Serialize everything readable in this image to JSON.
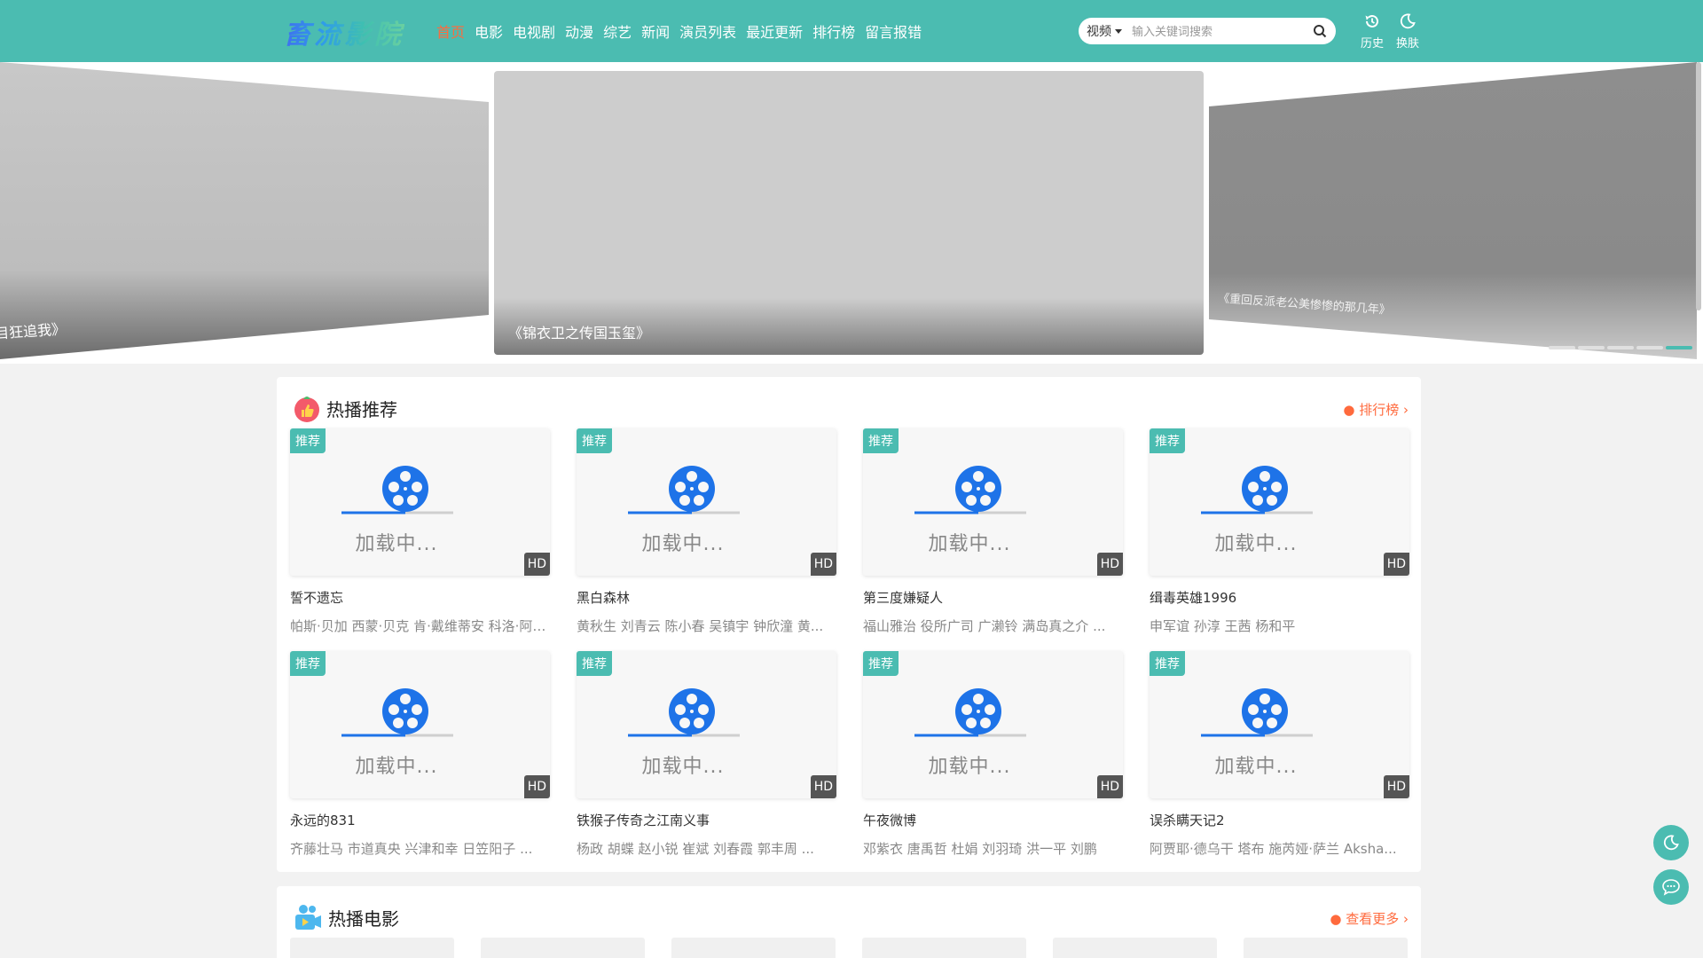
{
  "header": {
    "logo_text": "畜流影院",
    "nav": [
      "首页",
      "电影",
      "电视剧",
      "动漫",
      "综艺",
      "新闻",
      "演员列表",
      "最近更新",
      "排行榜",
      "留言报错"
    ],
    "search_type": "视频",
    "search_placeholder": "输入关键词搜索",
    "history_label": "历史",
    "theme_label": "换肤"
  },
  "carousel": {
    "left_caption": "目狂追我》",
    "center_caption": "《锦衣卫之传国玉玺》",
    "right_caption": "《重回反派老公美惨惨的那几年》",
    "active_dot": 4
  },
  "hot": {
    "title": "热播推荐",
    "more": "排行榜",
    "items": [
      {
        "badge": "推荐",
        "quality": "HD",
        "loading": "加载中...",
        "name": "誓不遗忘",
        "cast": "帕斯·贝加 西蒙·贝克 肯·戴维蒂安 科洛·阿林托 ..."
      },
      {
        "badge": "推荐",
        "quality": "HD",
        "loading": "加载中...",
        "name": "黑白森林",
        "cast": "黄秋生 刘青云 陈小春 吴镇宇 钟欣潼 黄..."
      },
      {
        "badge": "推荐",
        "quality": "HD",
        "loading": "加载中...",
        "name": "第三度嫌疑人",
        "cast": "福山雅治 役所广司 广濑铃 满岛真之介 ..."
      },
      {
        "badge": "推荐",
        "quality": "HD",
        "loading": "加载中...",
        "name": "缉毒英雄1996",
        "cast": "申军谊 孙淳 王茜 杨和平"
      },
      {
        "badge": "推荐",
        "quality": "HD",
        "loading": "加载中...",
        "name": "永远的831",
        "cast": "齐藤壮马 市道真央 兴津和幸 日笠阳子 ..."
      },
      {
        "badge": "推荐",
        "quality": "HD",
        "loading": "加载中...",
        "name": "铁猴子传奇之江南义事",
        "cast": "杨政 胡蝶 赵小锐 崔斌 刘春霞 郭丰周 ..."
      },
      {
        "badge": "推荐",
        "quality": "HD",
        "loading": "加载中...",
        "name": "午夜微博",
        "cast": "邓紫衣 唐禹哲 杜娟 刘羽琦 洪一平 刘鹏"
      },
      {
        "badge": "推荐",
        "quality": "HD",
        "loading": "加载中...",
        "name": "误杀瞒天记2",
        "cast": "阿贾耶·德乌干 塔布 施芮娅·萨兰 Aksha..."
      }
    ]
  },
  "movies": {
    "title": "热播电影",
    "more": "查看更多"
  },
  "colors": {
    "theme": "#4bbcb1",
    "active_nav": "#ff6a3d",
    "reel_blue": "#1e73e8"
  }
}
